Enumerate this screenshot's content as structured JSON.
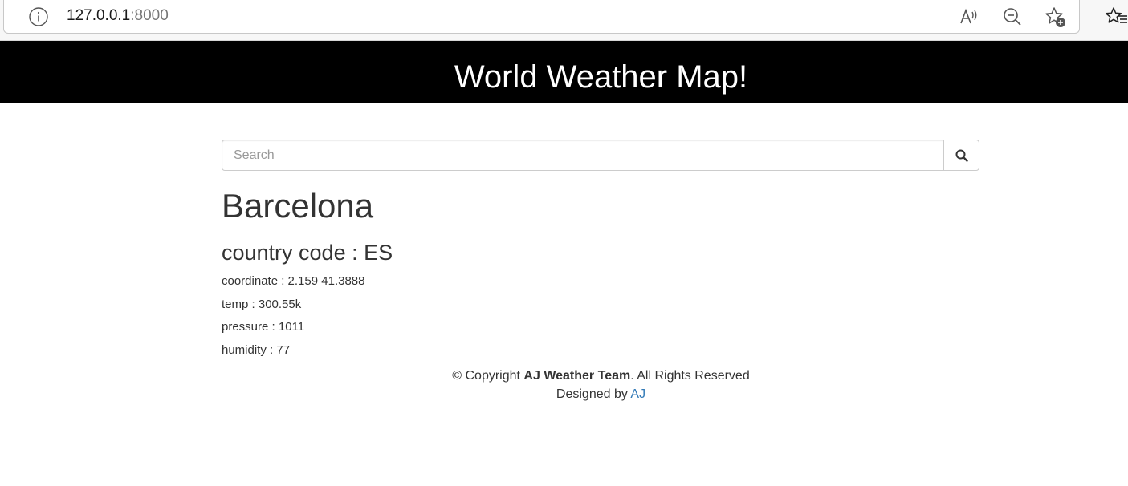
{
  "browser": {
    "url_host": "127.0.0.1",
    "url_port": ":8000",
    "icons": [
      "info-icon",
      "read-aloud-icon",
      "zoom-out-icon",
      "add-favorite-icon",
      "favorites-icon"
    ]
  },
  "header": {
    "title": "World Weather Map!",
    "background": "#000000",
    "text_color": "#ffffff"
  },
  "search": {
    "placeholder": "Search",
    "value": ""
  },
  "weather": {
    "city": "Barcelona",
    "country_line": "country code : ES",
    "coordinate_line": "coordinate : 2.159 41.3888",
    "temp_line": "temp : 300.55k",
    "pressure_line": "pressure : 1011",
    "humidity_line": "humidity : 77"
  },
  "footer": {
    "copyright_prefix": "© Copyright ",
    "team": "AJ Weather Team",
    "copyright_suffix": ". All Rights Reserved",
    "designed_by": "Designed by ",
    "designer_link": "AJ",
    "link_color": "#337ab7"
  }
}
